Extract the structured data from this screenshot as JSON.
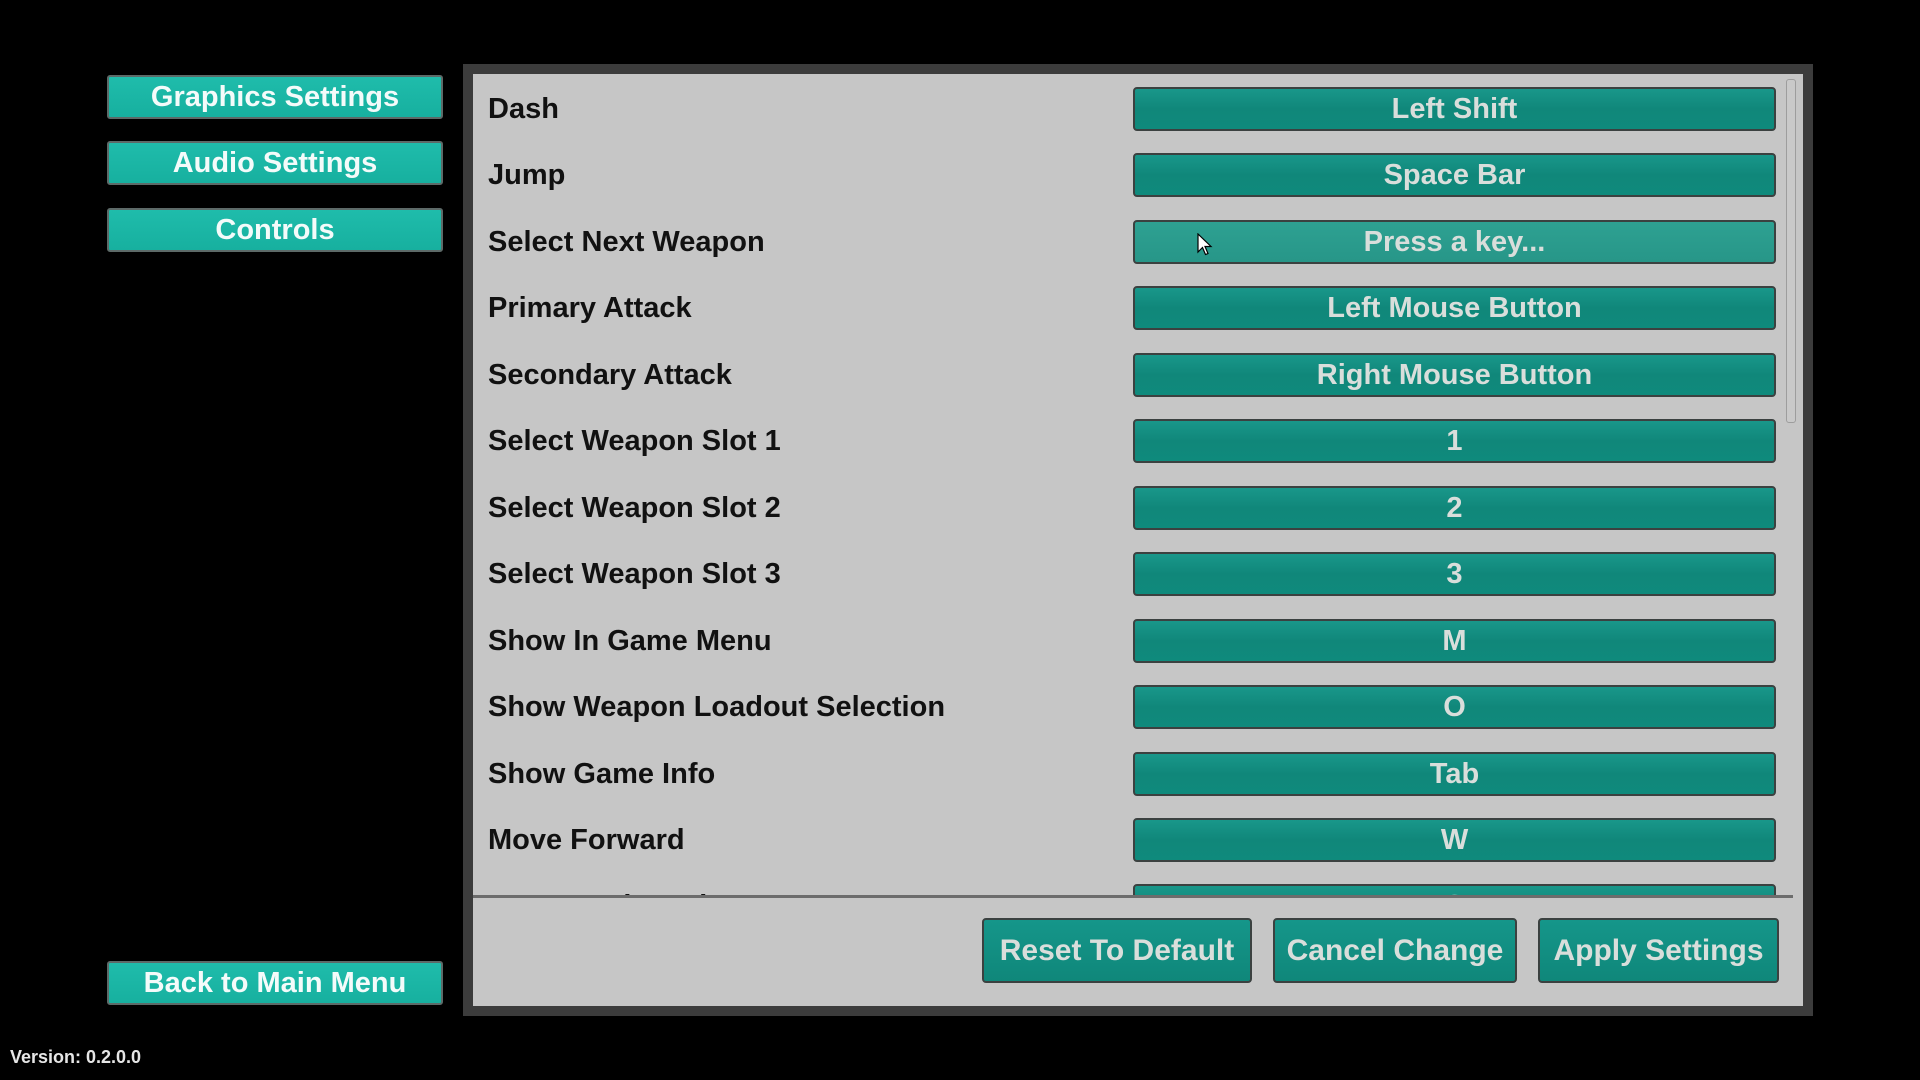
{
  "sidebar": {
    "items": [
      {
        "label": "Graphics Settings"
      },
      {
        "label": "Audio Settings"
      },
      {
        "label": "Controls"
      }
    ],
    "back_label": "Back to Main Menu"
  },
  "version": "Version: 0.2.0.0",
  "controls": {
    "rows": [
      {
        "action": "Dash",
        "key": "Left Shift"
      },
      {
        "action": "Jump",
        "key": "Space Bar"
      },
      {
        "action": "Select Next Weapon",
        "key": "Press a key...",
        "listening": true
      },
      {
        "action": "Primary Attack",
        "key": "Left Mouse Button"
      },
      {
        "action": "Secondary Attack",
        "key": "Right Mouse Button"
      },
      {
        "action": "Select Weapon Slot 1",
        "key": "1"
      },
      {
        "action": "Select Weapon Slot 2",
        "key": "2"
      },
      {
        "action": "Select Weapon Slot 3",
        "key": "3"
      },
      {
        "action": "Show In Game Menu",
        "key": "M"
      },
      {
        "action": "Show Weapon Loadout Selection",
        "key": "O"
      },
      {
        "action": "Show Game Info",
        "key": "Tab"
      },
      {
        "action": "Move Forward",
        "key": "W"
      },
      {
        "action": "Move Backward",
        "key": "S"
      }
    ],
    "scroll_fraction": 0.0
  },
  "actions": {
    "reset_label": "Reset To Default",
    "cancel_label": "Cancel Change",
    "apply_label": "Apply Settings"
  },
  "colors": {
    "sidebar_button": "#1bb8a6",
    "key_button": "#118a7e",
    "panel_bg": "#c6c6c6",
    "panel_border": "#3c3c3c"
  }
}
